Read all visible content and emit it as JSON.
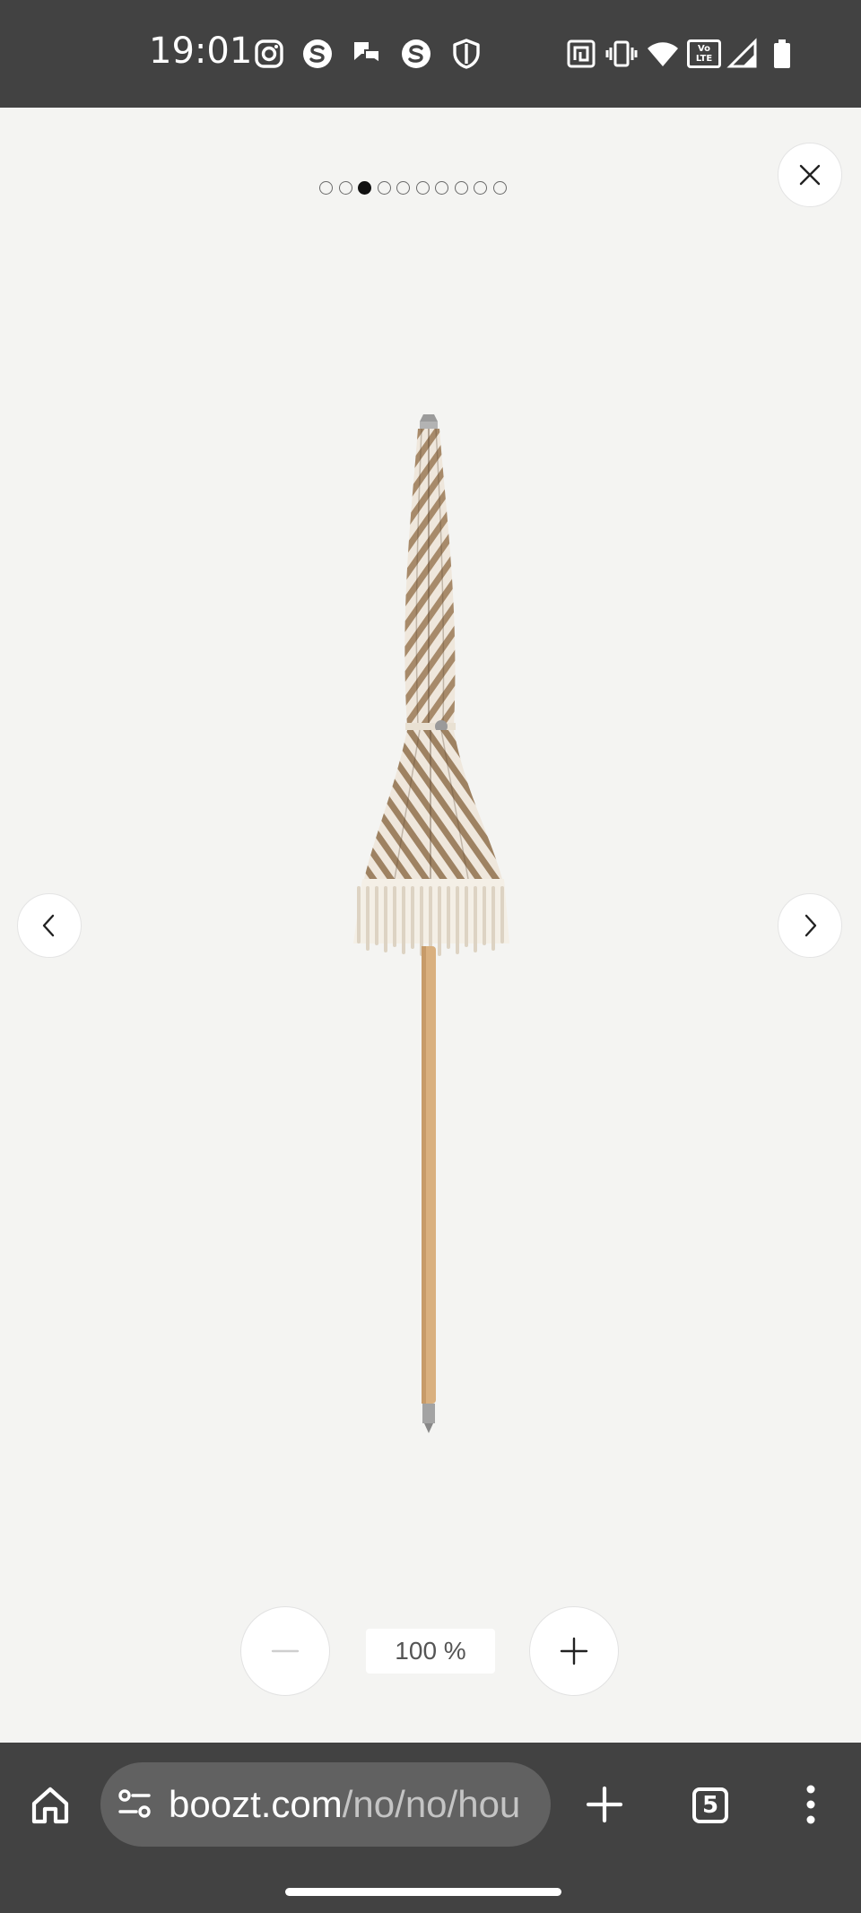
{
  "status_bar": {
    "time": "19:01",
    "left_icons": [
      "instagram-icon",
      "s-app-icon",
      "chat-app-icon",
      "s-app-icon",
      "shield-icon"
    ],
    "right_icons": [
      "nfc-icon",
      "vibrate-icon",
      "wifi-icon",
      "volte-icon",
      "signal-icon",
      "battery-icon"
    ],
    "volte_label": "Vo LTE"
  },
  "gallery": {
    "total_images": 10,
    "active_index": 2,
    "zoom_level": "100 %"
  },
  "browser": {
    "url_domain": "boozt.com",
    "url_path": "/no/no/hou",
    "tab_count": "5"
  },
  "colors": {
    "system_bar": "#424242",
    "viewer_bg": "#f4f4f2",
    "url_pill": "#616161"
  }
}
